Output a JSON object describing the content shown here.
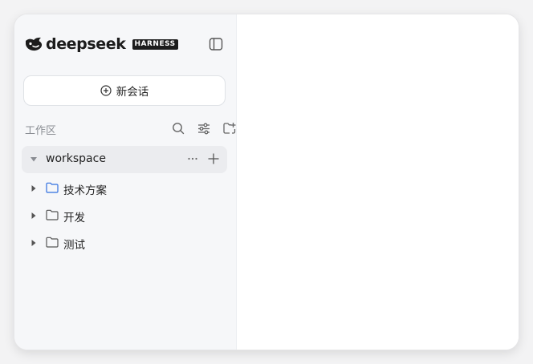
{
  "brand": {
    "name": "deepseek",
    "badge": "HARNESS"
  },
  "new_chat": {
    "label": "新会话"
  },
  "workspace_section": {
    "title": "工作区"
  },
  "tree": {
    "root": {
      "label": "workspace",
      "more_label": "···"
    },
    "folders": [
      {
        "label": "技术方案",
        "highlighted": true
      },
      {
        "label": "开发",
        "highlighted": false
      },
      {
        "label": "测试",
        "highlighted": false
      }
    ]
  },
  "colors": {
    "highlight_folder": "#2f6fe0",
    "muted": "#8a8d93"
  }
}
